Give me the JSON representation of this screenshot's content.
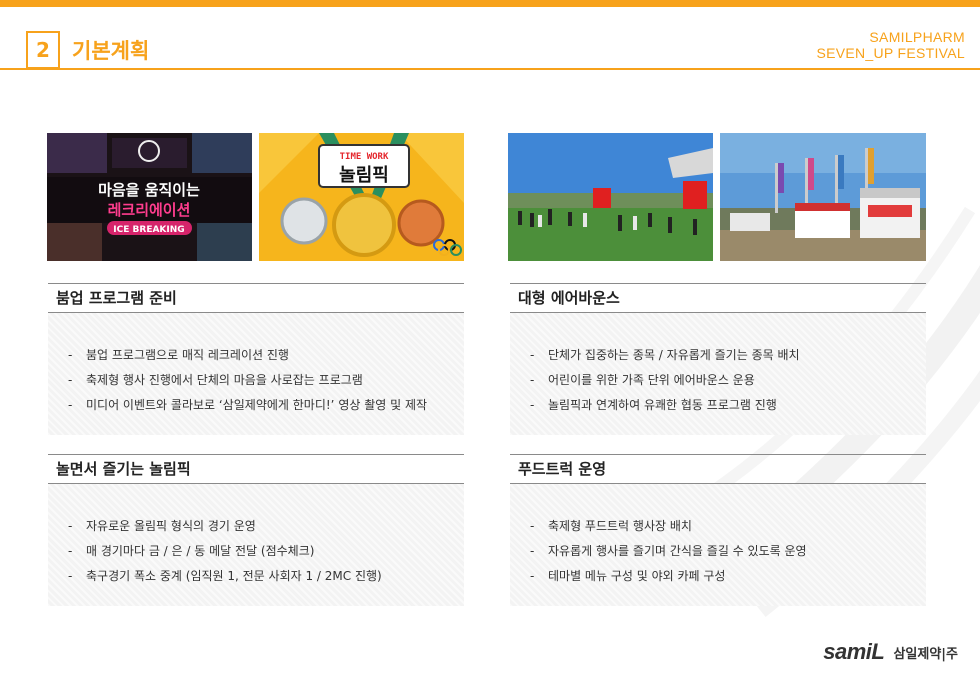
{
  "header": {
    "section_number": "2",
    "section_title": "기본계획",
    "brand_line1": "SAMILPHARM",
    "brand_line2": "SEVEN_UP FESTIVAL"
  },
  "photos": {
    "recreation_banner": {
      "headline1": "마음을 움직이는",
      "headline2": "레크리에이션",
      "tag": "ICE BREAKING"
    },
    "olympic_banner": {
      "tag": "TIME WORK",
      "title": "놀림픽"
    }
  },
  "sections": [
    {
      "title": "붐업 프로그램 준비",
      "bullets": [
        "붐업 프로그램으로 매직 레크레이션 진행",
        "축제형 행사 진행에서 단체의 마음을 사로잡는 프로그램",
        "미디어 이벤트와 콜라보로 ‘삼일제약에게 한마디!’ 영상 촬영 및 제작"
      ]
    },
    {
      "title": "대형 에어바운스",
      "bullets": [
        "단체가 집중하는 종목 / 자유롭게 즐기는 종목 배치",
        "어린이를 위한 가족 단위 에어바운스 운용",
        "놀림픽과 연계하여 유쾌한 협동 프로그램 진행"
      ]
    },
    {
      "title": "놀면서 즐기는 놀림픽",
      "bullets": [
        "자유로운 올림픽 형식의 경기 운영",
        "매 경기마다 금 / 은 / 동 메달 전달 (점수체크)",
        "축구경기 폭소 중계 (임직원 1, 전문 사회자 1 / 2MC 진행)"
      ]
    },
    {
      "title": "푸드트럭 운영",
      "bullets": [
        "축제형 푸드트럭 행사장 배치",
        "자유롭게 행사를 즐기며 간식을 즐길 수 있도록 운영",
        "테마별 메뉴 구성 및 야외 카페 구성"
      ]
    }
  ],
  "footer": {
    "logo_text": "samiL",
    "logo_kr": "삼일제약|주"
  },
  "colors": {
    "accent": "#f7a21b",
    "logo_red": "#e4262c"
  }
}
